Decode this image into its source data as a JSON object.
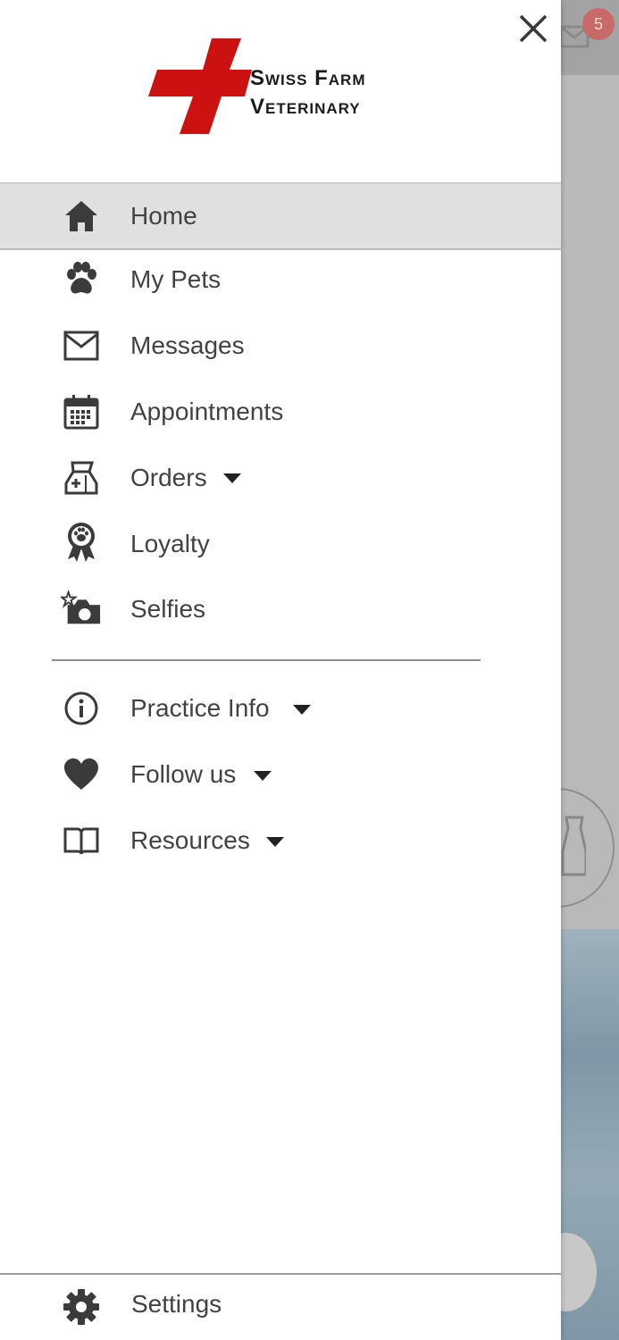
{
  "background": {
    "badge_count": "5"
  },
  "drawer": {
    "logo": {
      "line1": "Swiss Farm",
      "line2": "Veterinary",
      "brand_color": "#cc1111"
    },
    "close_icon": "close-icon",
    "menu": {
      "home": {
        "label": "Home",
        "icon": "home-icon"
      },
      "my_pets": {
        "label": "My Pets",
        "icon": "paw-icon"
      },
      "messages": {
        "label": "Messages",
        "icon": "envelope-icon"
      },
      "appointments": {
        "label": "Appointments",
        "icon": "calendar-icon"
      },
      "orders": {
        "label": "Orders",
        "icon": "pet-food-bag-icon"
      },
      "loyalty": {
        "label": "Loyalty",
        "icon": "award-ribbon-icon"
      },
      "selfies": {
        "label": "Selfies",
        "icon": "camera-icon"
      },
      "practice_info": {
        "label": "Practice Info",
        "icon": "info-icon"
      },
      "follow_us": {
        "label": "Follow us",
        "icon": "heart-icon"
      },
      "resources": {
        "label": "Resources",
        "icon": "book-icon"
      }
    },
    "settings": {
      "label": "Settings",
      "icon": "gear-icon"
    }
  }
}
